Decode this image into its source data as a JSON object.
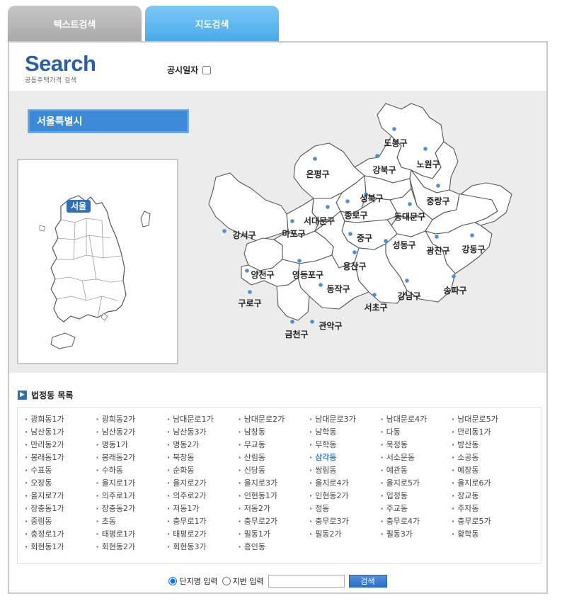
{
  "tabs": [
    {
      "label": "텍스트검색",
      "active": false
    },
    {
      "label": "지도검색",
      "active": true
    }
  ],
  "logo": {
    "title": "Search",
    "subtitle": "공동주택가격 검색"
  },
  "pubdate_label": "공시일자",
  "region": {
    "title": "서울특별시",
    "marker": "서울"
  },
  "districts": [
    "도봉구",
    "노원구",
    "강북구",
    "은평구",
    "성북구",
    "중랑구",
    "종로구",
    "동대문구",
    "서대문구",
    "마포구",
    "강서구",
    "중구",
    "성동구",
    "광진구",
    "강동구",
    "용산구",
    "양천구",
    "영등포구",
    "동작구",
    "송파구",
    "강남구",
    "서초구",
    "구로구",
    "관악구",
    "금천구"
  ],
  "dong_section_title": "법정동 목록",
  "dong_list": [
    "광희동1가",
    "광희동2가",
    "남대문로1가",
    "남대문로2가",
    "남대문로3가",
    "남대문로4가",
    "남대문로5가",
    "남산동1가",
    "남산동2가",
    "남산동3가",
    "남창동",
    "남학동",
    "다동",
    "만리동1가",
    "만리동2가",
    "명동1가",
    "명동2가",
    "무교동",
    "무학동",
    "묵정동",
    "방산동",
    "봉래동1가",
    "봉래동2가",
    "북창동",
    "산림동",
    "삼각동",
    "서소문동",
    "소공동",
    "수표동",
    "수하동",
    "순화동",
    "신당동",
    "쌍림동",
    "예관동",
    "예장동",
    "오장동",
    "을지로1가",
    "을지로2가",
    "을지로3가",
    "을지로4가",
    "을지로5가",
    "을지로6가",
    "을지로7가",
    "의주로1가",
    "의주로2가",
    "인현동1가",
    "인현동2가",
    "입정동",
    "장교동",
    "장충동1가",
    "장충동2가",
    "저동1가",
    "저동2가",
    "정동",
    "주교동",
    "주자동",
    "중림동",
    "초동",
    "충무로1가",
    "충무로2가",
    "충무로3가",
    "충무로4가",
    "충무로5가",
    "충정로1가",
    "태평로1가",
    "태평로2가",
    "필동1가",
    "필동2가",
    "필동3가",
    "황학동",
    "회현동1가",
    "회현동2가",
    "회현동3가",
    "흥인동"
  ],
  "active_dong": "삼각동",
  "search_bar": {
    "option1": "단지명 입력",
    "option2": "지번 입력",
    "button": "검색"
  },
  "colors": {
    "tab_active": "#49aaea",
    "region_title": "#3c89d8",
    "district_dot": "#4a90d9"
  }
}
